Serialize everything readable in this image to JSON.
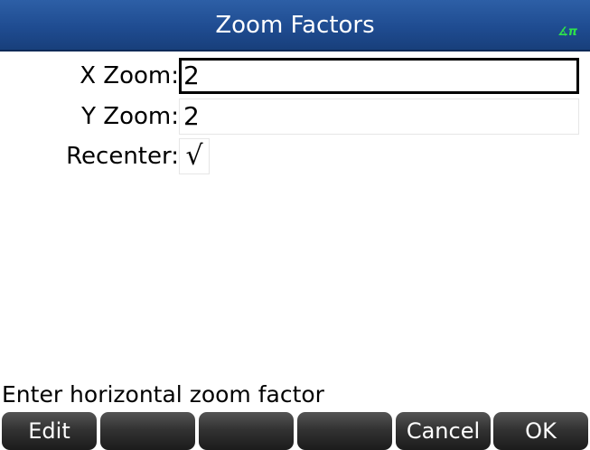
{
  "header": {
    "title": "Zoom Factors",
    "angle_mode_icon": "angle-pi-icon",
    "angle_mode_text": "∡π",
    "background_color": "#1f4c91",
    "angle_indicator_color": "#2ee34a"
  },
  "form": {
    "x_zoom": {
      "label": "X Zoom:",
      "value": "2",
      "selected": true
    },
    "y_zoom": {
      "label": "Y Zoom:",
      "value": "2"
    },
    "recenter": {
      "label": "Recenter:",
      "checked": true,
      "check_mark": "√"
    }
  },
  "help_text": "Enter horizontal zoom factor",
  "softkeys": [
    {
      "label": "Edit"
    },
    {
      "label": ""
    },
    {
      "label": ""
    },
    {
      "label": ""
    },
    {
      "label": "Cancel"
    },
    {
      "label": "OK"
    }
  ]
}
